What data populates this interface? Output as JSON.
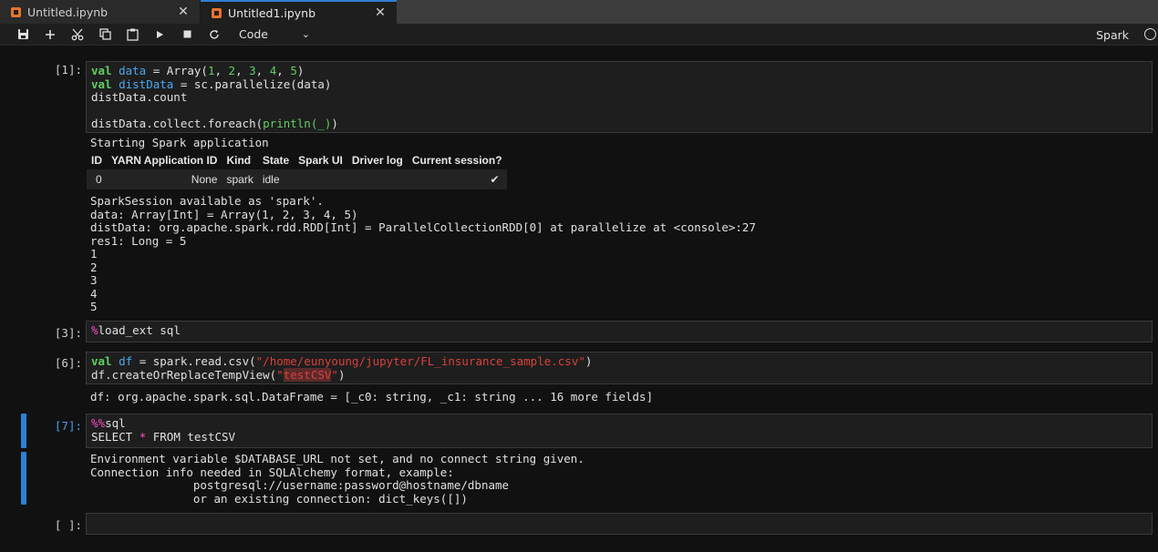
{
  "tabs": [
    {
      "label": "Untitled.ipynb",
      "active": false
    },
    {
      "label": "Untitled1.ipynb",
      "active": true
    }
  ],
  "toolbar": {
    "cell_type": "Code",
    "kernel": "Spark",
    "icons": [
      "save-icon",
      "add-icon",
      "cut-icon",
      "copy-icon",
      "paste-icon",
      "run-icon",
      "stop-icon",
      "restart-icon"
    ]
  },
  "cells": [
    {
      "prompt": "[1]:",
      "code": {
        "l1_kw": "val",
        "l1_var": "data",
        "l1_mid": " = Array(",
        "l1_a": "1",
        "l1_b": "2",
        "l1_c": "3",
        "l1_d": "4",
        "l1_e": "5",
        "l1_end": ")",
        "l2_kw": "val",
        "l2_var": "distData",
        "l2_rest": " = sc.parallelize(data)",
        "l3": "distData.count",
        "l5_a": "distData.collect.foreach(",
        "l5_fn": "println(_)",
        "l5_end": ")"
      },
      "output": {
        "starting": "Starting Spark application",
        "table_headers": [
          "ID",
          "YARN Application ID",
          "Kind",
          "State",
          "Spark UI",
          "Driver log",
          "Current session?"
        ],
        "table_row": [
          "0",
          "None",
          "spark",
          "idle",
          "",
          "",
          "✔"
        ],
        "lines": [
          "SparkSession available as 'spark'.",
          "data: Array[Int] = Array(1, 2, 3, 4, 5)",
          "distData: org.apache.spark.rdd.RDD[Int] = ParallelCollectionRDD[0] at parallelize at <console>:27",
          "res1: Long = 5",
          "1",
          "2",
          "3",
          "4",
          "5"
        ]
      }
    },
    {
      "prompt": "[3]:",
      "code": {
        "magic": "%",
        "rest": "load_ext sql"
      }
    },
    {
      "prompt": "[6]:",
      "code": {
        "l1_kw": "val",
        "l1_var": "df",
        "l1_mid": " = spark.read.csv(",
        "l1_str": "\"/home/eunyoung/jupyter/FL_insurance_sample.csv\"",
        "l1_end": ")",
        "l2_a": "df.createOrReplaceTempView(",
        "l2_q1": "\"",
        "l2_hl": "testCSV",
        "l2_q2": "\"",
        "l2_end": ")"
      },
      "output": {
        "line": "df: org.apache.spark.sql.DataFrame = [_c0: string, _c1: string ... 16 more fields]"
      }
    },
    {
      "prompt": "[7]:",
      "code": {
        "magic": "%%",
        "magic_word": "sql",
        "l2_a": "SELECT ",
        "l2_star": "*",
        "l2_b": " FROM testCSV"
      },
      "output": {
        "lines": [
          "Environment variable $DATABASE_URL not set, and no connect string given.",
          "Connection info needed in SQLAlchemy format, example:",
          "               postgresql://username:password@hostname/dbname",
          "               or an existing connection: dict_keys([])"
        ]
      }
    },
    {
      "prompt": "[ ]:",
      "code": {}
    }
  ],
  "colors": {
    "accent": "#2f7fd5",
    "keyword": "#5fcf5f",
    "string": "#d9403a",
    "magic": "#ff4fc7",
    "definition": "#4aa8f0"
  }
}
